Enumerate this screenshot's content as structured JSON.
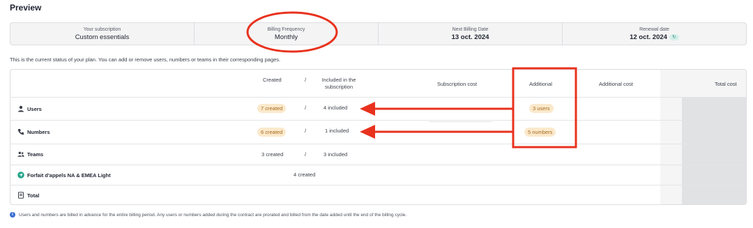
{
  "page": {
    "title": "Preview"
  },
  "summary": [
    {
      "label": "Your subscription",
      "value": "Custom essentials"
    },
    {
      "label": "Billing Frequency",
      "value": "Monthly"
    },
    {
      "label": "Next Billing Date",
      "value": "13 oct. 2024"
    },
    {
      "label": "Renewal date",
      "value": "12 oct. 2024",
      "badge_icon": "refresh-icon"
    }
  ],
  "status_text": "This is the current status of your plan. You can add or remove users, numbers or teams in their corresponding pages.",
  "table": {
    "headers": {
      "created": "Created",
      "separator": "/",
      "included": "Included in the subscription",
      "subscription_cost": "Subscription cost",
      "additional": "Additional",
      "additional_cost": "Additional cost",
      "total_cost": "Total cost"
    },
    "rows": [
      {
        "label": "Users",
        "icon": "user-icon",
        "created": "7 created",
        "separator": "/",
        "included": "4 included",
        "additional": "3 users"
      },
      {
        "label": "Numbers",
        "icon": "phone-icon",
        "created": "6 created",
        "separator": "/",
        "included": "1 included",
        "additional": "5 numbers"
      },
      {
        "label": "Teams",
        "icon": "team-icon",
        "created": "3 created",
        "separator": "/",
        "included": "3 included"
      },
      {
        "label": "Forfait d'appels NA & EMEA Light",
        "icon": "call-plan-icon",
        "created": "4 created"
      },
      {
        "label": "Total",
        "icon": "receipt-icon"
      }
    ]
  },
  "footer": {
    "icon": "info-icon",
    "text": "Users and numbers are billed in advance for the entire billing period. Any users or numbers added during the contract are prorated and billed from the date added until the end of the billing cycle."
  },
  "colors": {
    "annotation_red": "#e8321e",
    "pill_bg": "#fbe9cc",
    "pill_text": "#a66a1c",
    "renew_badge": "#2d8f7c"
  }
}
